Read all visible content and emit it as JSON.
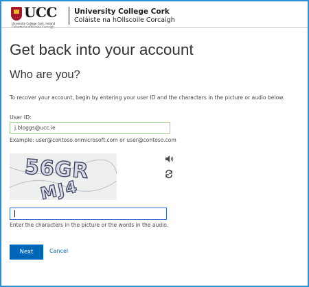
{
  "header": {
    "logo_text": "UCC",
    "logo_subline_1": "University College Cork, Ireland",
    "logo_subline_2": "Coláiste na hOllscoile Corcaigh",
    "org_name": "University College Cork",
    "org_name_irish": "Coláiste na hOllscoile Corcaigh"
  },
  "page": {
    "title": "Get back into your account",
    "subtitle": "Who are you?",
    "instructions": "To recover your account, begin by entering your user ID and the characters in the picture or audio below."
  },
  "form": {
    "user_id_label": "User ID:",
    "user_id_value": "j.bloggs@ucc.ie",
    "example": "Example: user@contoso.onmicrosoft.com or user@contoso.com",
    "captcha_text_line1": "56GR",
    "captcha_text_line2": "MJ4",
    "captcha_value": "",
    "captcha_hint": "Enter the characters in the picture or the words in the audio."
  },
  "icons": {
    "audio": "speaker-icon",
    "refresh": "refresh-icon"
  },
  "actions": {
    "next_label": "Next",
    "cancel_label": "Cancel"
  },
  "colors": {
    "accent": "#0067b8",
    "frame_border": "#2a8fd6",
    "brand_red": "#a5162b"
  }
}
